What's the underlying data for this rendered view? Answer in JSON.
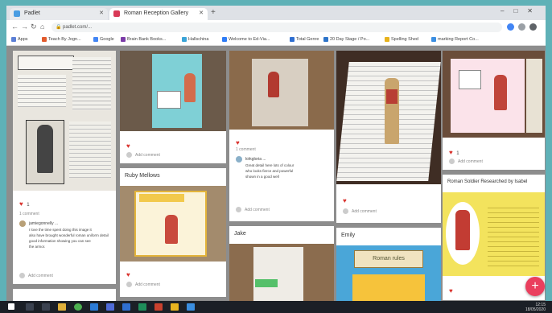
{
  "browser": {
    "tabs": [
      {
        "label": "Padlet",
        "active": false
      },
      {
        "label": "Roman Reception Gallery",
        "active": true
      }
    ],
    "new_tab_icon": "plus-icon",
    "url": "padlet.com/...",
    "bookmarks": [
      {
        "label": "Apps",
        "color": "#5b7fd6"
      },
      {
        "label": "Teach By Jogn...",
        "color": "#e25b2d"
      },
      {
        "label": "Google",
        "color": "#4285f4"
      },
      {
        "label": "Brain Bank Books...",
        "color": "#7b3ba8"
      },
      {
        "label": "Hallschina",
        "color": "#3aa4d8"
      },
      {
        "label": "Welcome to Ed-Via...",
        "color": "#2e7cf6"
      },
      {
        "label": "Total Genre",
        "color": "#2f6fd1"
      },
      {
        "label": "20 Day Stage / Po...",
        "color": "#2d74c9"
      },
      {
        "label": "Spelling Shed",
        "color": "#e7b21c"
      },
      {
        "label": "marking Report Co...",
        "color": "#3b8fe2"
      }
    ]
  },
  "board": {
    "col1": {
      "likes": "1",
      "comment_count": "1 comment",
      "author": "jamiegonnelly ...",
      "comment": "I love the time spent doing this image it",
      "comment2": "also have brought wonderful roman uniform detail",
      "comment3": "good information showing you can see",
      "comment4": "the armor.",
      "add_comment": "Add comment"
    },
    "col2": {
      "likes_a": "",
      "add_comment_a": "Add comment",
      "name_b": "Ruby Mellows",
      "likes_b": "",
      "add_comment_b": "Add comment"
    },
    "col3": {
      "likes_a": "",
      "comment_count": "1 comment",
      "author": "kirkgloria ...",
      "comment": "Great detail here lots of colour",
      "comment2": "who looks fierce and powerful",
      "comment3": "shown in a good well",
      "add_comment": "Add comment",
      "name_b": "Jake"
    },
    "col4": {
      "likes_a": "",
      "add_comment_a": "Add comment",
      "name_b": "Emily",
      "sign_text": "Roman rules"
    },
    "col5": {
      "likes_a": "1",
      "add_comment_a": "Add comment",
      "name_b": "Roman Soldier Researched by Isabel",
      "likes_b": ""
    }
  },
  "fab_label": "+",
  "taskbar": {
    "time": "12:15",
    "date": "18/05/2020"
  }
}
